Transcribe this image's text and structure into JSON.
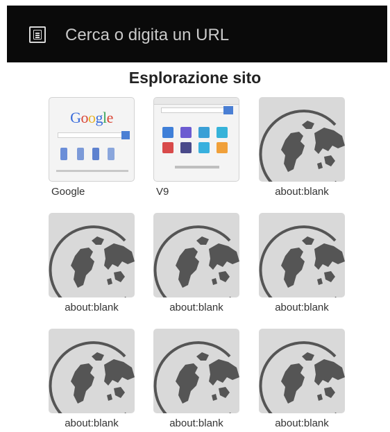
{
  "url_bar": {
    "placeholder": "Cerca o digita un URL",
    "icon": "page-icon"
  },
  "section_title": "Esplorazione sito",
  "tiles": [
    {
      "label": "Google",
      "thumbnail": "google-preview"
    },
    {
      "label": "V9",
      "thumbnail": "v9-preview"
    },
    {
      "label": "about:blank",
      "thumbnail": "globe-icon"
    },
    {
      "label": "about:blank",
      "thumbnail": "globe-icon"
    },
    {
      "label": "about:blank",
      "thumbnail": "globe-icon"
    },
    {
      "label": "about:blank",
      "thumbnail": "globe-icon"
    },
    {
      "label": "about:blank",
      "thumbnail": "globe-icon"
    },
    {
      "label": "about:blank",
      "thumbnail": "globe-icon"
    },
    {
      "label": "about:blank",
      "thumbnail": "globe-icon"
    }
  ],
  "colors": {
    "url_bar_bg": "#0a0a0a",
    "thumb_bg": "#d9d9d9",
    "globe": "#555555"
  }
}
